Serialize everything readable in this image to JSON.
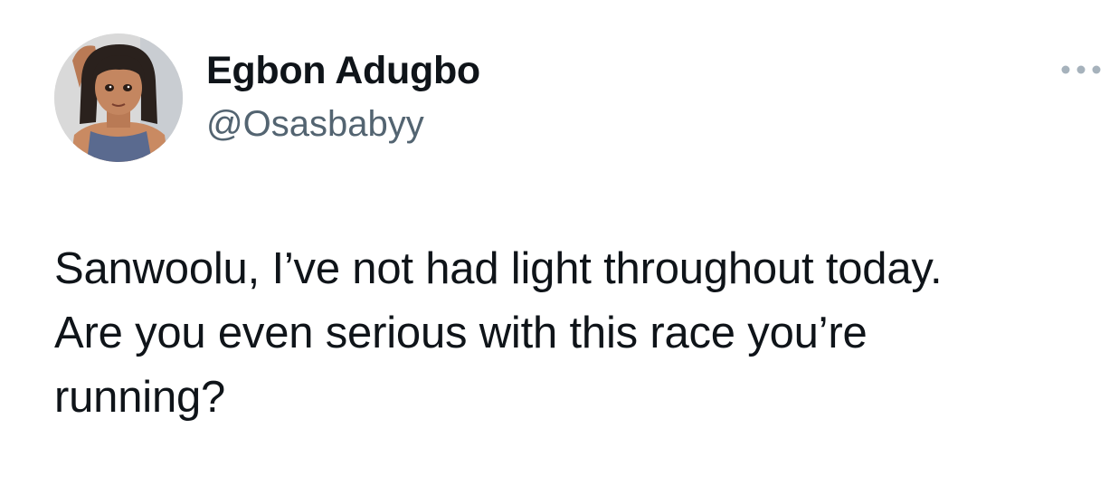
{
  "author": {
    "display_name": "Egbon Adugbo",
    "handle": "@Osasbabyy"
  },
  "icons": {
    "avatar": "profile-avatar-image",
    "more": "more-options-ellipsis-icon"
  },
  "tweet": {
    "lines": [
      "Sanwoolu, I’ve not had light throughout today.",
      "Are you even serious with this race you’re",
      "running?"
    ]
  },
  "colors": {
    "text_primary": "#0f1419",
    "text_secondary": "#536471",
    "background": "#ffffff"
  }
}
